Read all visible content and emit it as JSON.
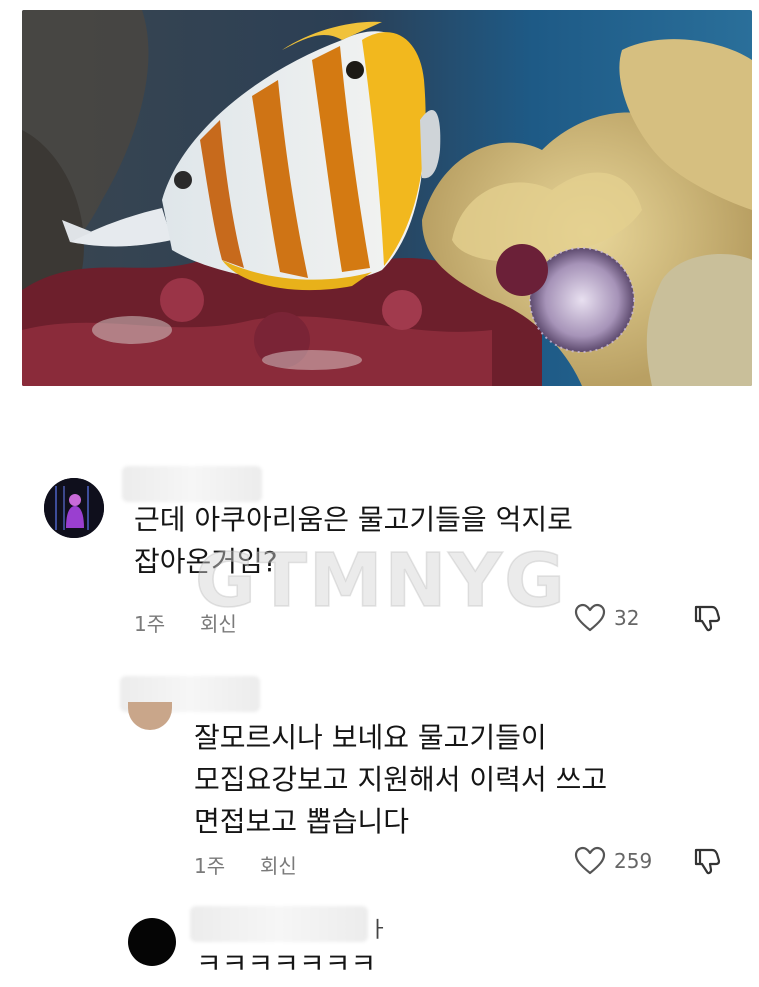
{
  "watermark": "GTMNYG",
  "comments": [
    {
      "text_lines": [
        "근데 아쿠아리움은 물고기들을 억지로",
        "잡아온거임?"
      ],
      "time": "1주",
      "reply_label": "회신",
      "likes": "32"
    },
    {
      "text_lines": [
        "잘모르시나 보네요 물고기들이",
        "모집요강보고 지원해서 이력서 쓰고",
        "면접보고 뽑습니다"
      ],
      "time": "1주",
      "reply_label": "회신",
      "likes": "259"
    },
    {
      "name_fragment": "ㅏ",
      "text_lines": [
        "ㅋㅋㅋㅋㅋㅋㅋ"
      ]
    }
  ],
  "icons": {
    "like": "heart-outline-icon",
    "dislike": "thumbs-down-icon"
  }
}
